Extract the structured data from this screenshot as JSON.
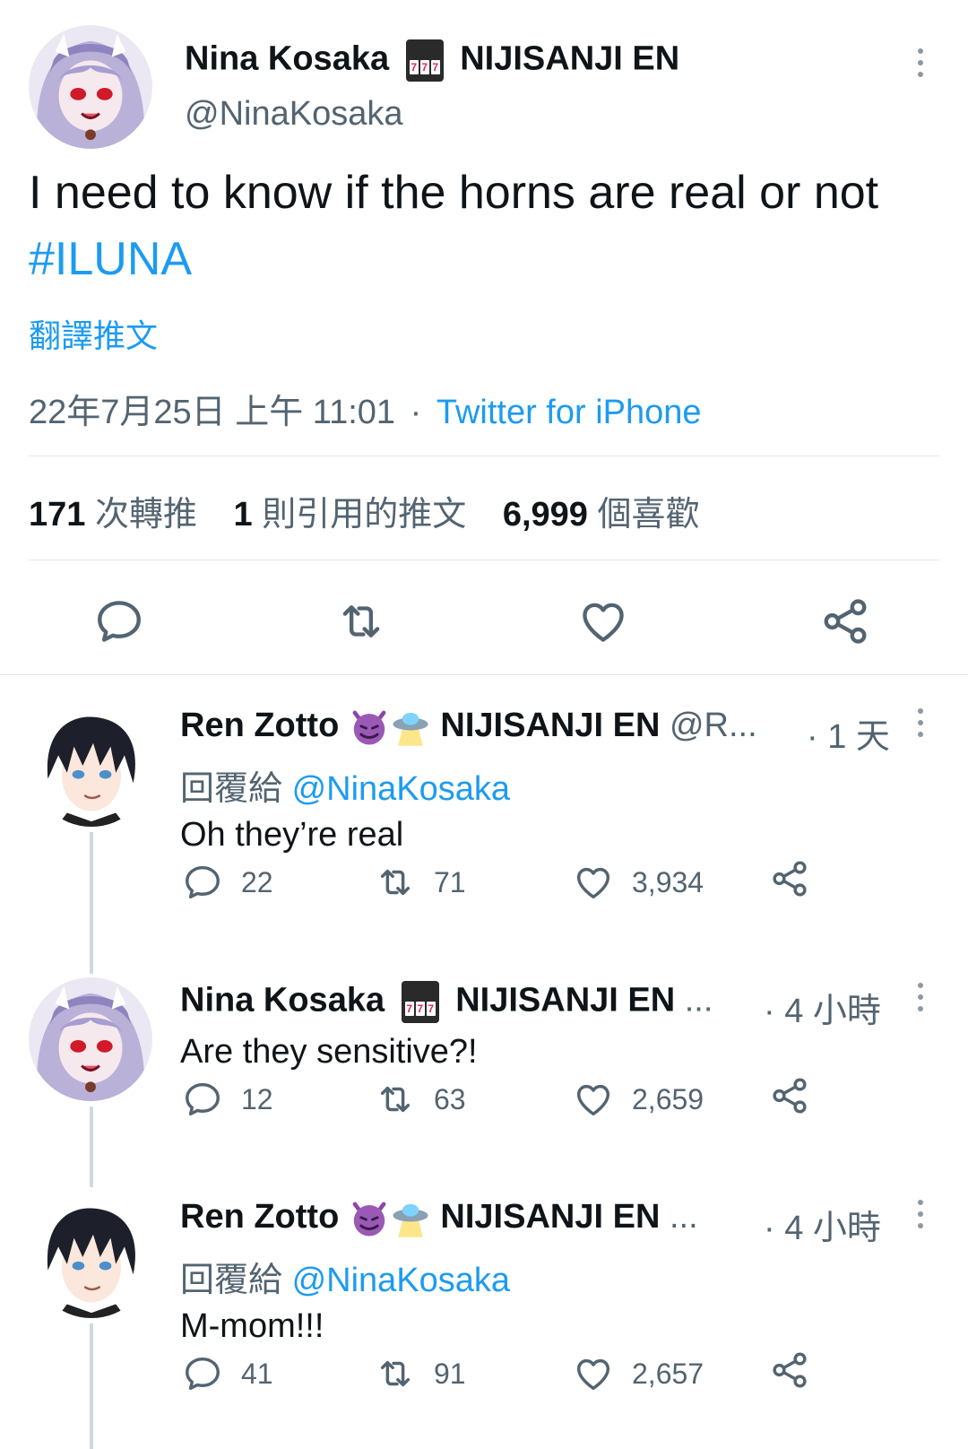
{
  "main_tweet": {
    "display_name": "Nina Kosaka",
    "org": "NIJISANJI EN",
    "handle": "@NinaKosaka",
    "text_before": "I need to know if the horns are real or not ",
    "hashtag": "#ILUNA",
    "translate_label": "翻譯推文",
    "timestamp": "22年7月25日 上午 11:01",
    "separator": "·",
    "source": "Twitter for iPhone",
    "stats": {
      "retweets_count": "171",
      "retweets_label": "次轉推",
      "quotes_count": "1",
      "quotes_label": "則引用的推文",
      "likes_count": "6,999",
      "likes_label": "個喜歡"
    },
    "actions": [
      "reply-icon",
      "retweet-icon",
      "like-icon",
      "share-icon"
    ]
  },
  "replies": [
    {
      "display_name": "Ren Zotto",
      "org": "NIJISANJI EN",
      "handle": "@R...",
      "time": "· 1 天",
      "reply_prefix": "回覆給",
      "reply_to": "@NinaKosaka",
      "text": "Oh they’re real",
      "reply_count": "22",
      "retweet_count": "71",
      "like_count": "3,934"
    },
    {
      "display_name": "Nina Kosaka",
      "org": "NIJISANJI EN",
      "handle": "...",
      "time": "· 4 小時",
      "text": "Are they sensitive?!",
      "reply_count": "12",
      "retweet_count": "63",
      "like_count": "2,659"
    },
    {
      "display_name": "Ren Zotto",
      "org": "NIJISANJI EN",
      "handle": "...",
      "time": "· 4 小時",
      "reply_prefix": "回覆給",
      "reply_to": "@NinaKosaka",
      "text": "M-mom!!!",
      "reply_count": "41",
      "retweet_count": "91",
      "like_count": "2,657"
    }
  ],
  "colors": {
    "link": "#1d9bf0",
    "muted": "#536471",
    "text": "#0f1419",
    "divider": "#e1e6ea"
  }
}
